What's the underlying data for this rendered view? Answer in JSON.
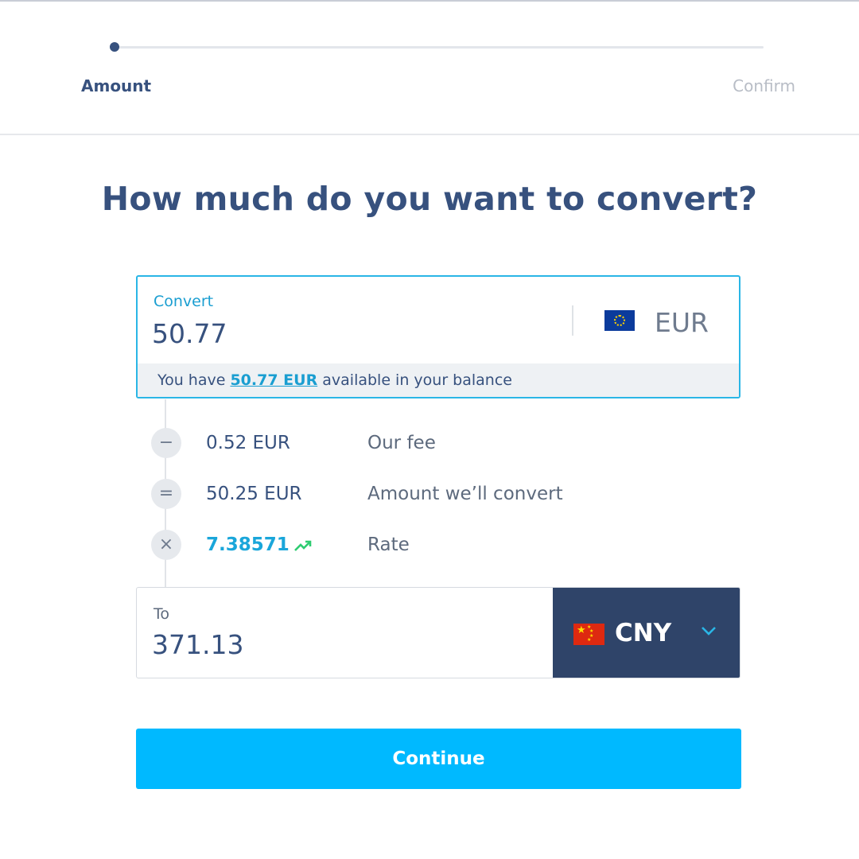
{
  "stepper": {
    "steps": [
      {
        "label": "Amount",
        "state": "active"
      },
      {
        "label": "Confirm",
        "state": "pending"
      }
    ]
  },
  "title": "How much do you want to convert?",
  "convert": {
    "label": "Convert",
    "amount": "50.77",
    "currency": "EUR",
    "balance": {
      "prefix": "You have ",
      "link": "50.77 EUR",
      "suffix": " available in your balance"
    }
  },
  "breakdown": [
    {
      "icon": "minus-icon",
      "symbol": "−",
      "amount": "0.52 EUR",
      "label": "Our fee"
    },
    {
      "icon": "equals-icon",
      "symbol": "=",
      "amount": "50.25 EUR",
      "label": "Amount we’ll convert"
    },
    {
      "icon": "multiply-icon",
      "symbol": "×",
      "amount": "7.38571",
      "label": "Rate"
    }
  ],
  "to": {
    "label": "To",
    "amount": "371.13",
    "currency": "CNY"
  },
  "continue_label": "Continue",
  "colors": {
    "accent": "#00b9ff",
    "navy": "#37517e",
    "select_bg": "#2f4469",
    "rate_trend": "#2ecc71"
  }
}
